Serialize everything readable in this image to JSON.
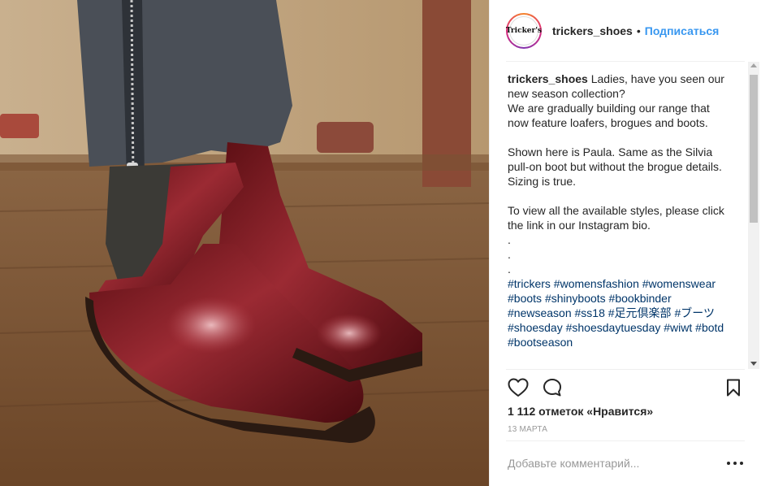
{
  "header": {
    "avatar_text": "Tricker's",
    "username": "trickers_shoes",
    "separator": "•",
    "follow_label": "Подписаться"
  },
  "caption": {
    "username": "trickers_shoes",
    "text": " Ladies, have you seen our new season collection?\nWe are gradually building our range that now feature loafers, brogues and boots.\n\nShown here is Paula. Same as the Silvia pull-on boot but without the brogue details. Sizing is true.\n\nTo view all the available styles, please click the link in our Instagram bio.\n.\n.\n.",
    "hashtags": [
      "#trickers",
      "#womensfashion",
      "#womenswear",
      "#boots",
      "#shinyboots",
      "#bookbinder",
      "#newseason",
      "#ss18",
      "#足元倶楽部",
      "#ブーツ",
      "#shoesday",
      "#shoesdaytuesday",
      "#wiwt",
      "#botd",
      "#bootseason"
    ]
  },
  "actions": {
    "like_icon": "heart-outline-icon",
    "comment_icon": "speech-bubble-icon",
    "save_icon": "bookmark-icon"
  },
  "likes_text": "1 112 отметок «Нравится»",
  "date_text": "13 марта",
  "comment": {
    "placeholder": "Добавьте комментарий..."
  },
  "colors": {
    "link_blue": "#3897f0",
    "hashtag": "#003569",
    "boot_red": "#7a1a1f"
  }
}
